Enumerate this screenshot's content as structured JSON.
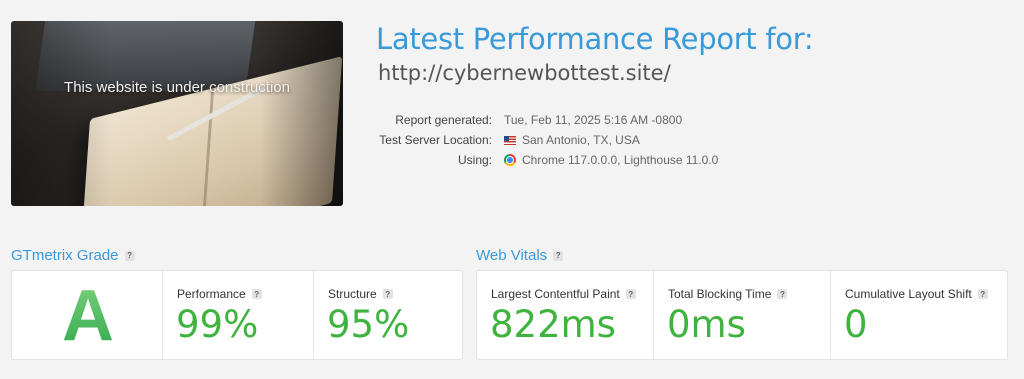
{
  "thumbnail": {
    "caption": "This website is under construction"
  },
  "header": {
    "title": "Latest Performance Report for:",
    "url": "http://cybernewbottest.site/"
  },
  "meta": {
    "report_generated_label": "Report generated:",
    "report_generated_value": "Tue, Feb 11, 2025 5:16 AM -0800",
    "server_label": "Test Server Location:",
    "server_value": "San Antonio, TX, USA",
    "using_label": "Using:",
    "using_value": "Chrome 117.0.0.0, Lighthouse 11.0.0",
    "icons": [
      "us-flag-icon",
      "chrome-icon"
    ]
  },
  "grade_section": {
    "title": "GTmetrix Grade",
    "help": "?",
    "grade": "A",
    "performance_label": "Performance",
    "performance_value": "99%",
    "structure_label": "Structure",
    "structure_value": "95%"
  },
  "vitals_section": {
    "title": "Web Vitals",
    "help": "?",
    "lcp_label": "Largest Contentful Paint",
    "lcp_value": "822ms",
    "tbt_label": "Total Blocking Time",
    "tbt_value": "0ms",
    "cls_label": "Cumulative Layout Shift",
    "cls_value": "0"
  },
  "colors": {
    "accent": "#3a9ad9",
    "good": "#3fb33f",
    "background": "#f3f3f3"
  }
}
